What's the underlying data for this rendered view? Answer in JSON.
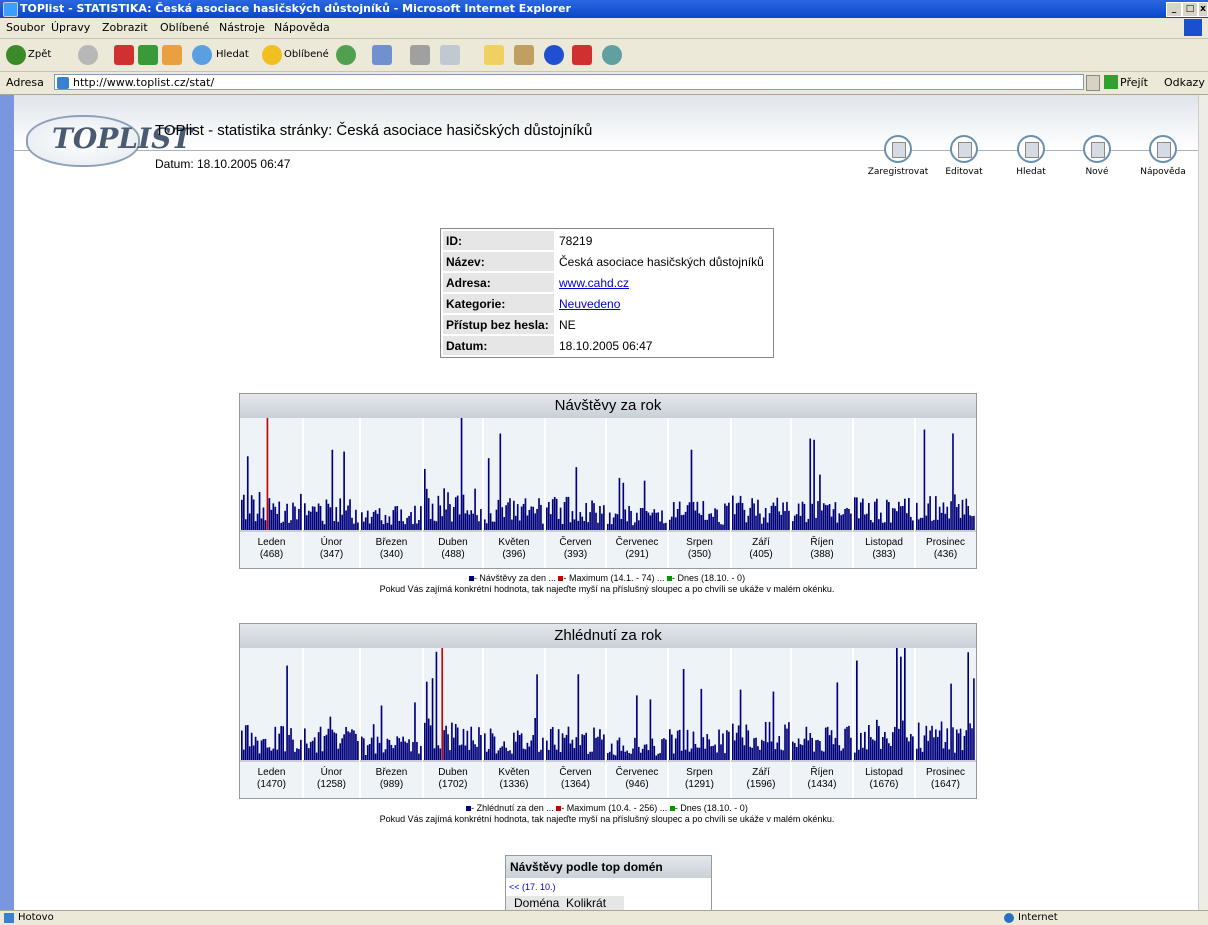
{
  "window": {
    "title": "TOPlist - STATISTIKA: Česká asociace hasičských důstojníků - Microsoft Internet Explorer"
  },
  "menu": [
    "Soubor",
    "Úpravy",
    "Zobrazit",
    "Oblíbené",
    "Nástroje",
    "Nápověda"
  ],
  "toolbar": {
    "back": "Zpět",
    "search": "Hledat",
    "favorites": "Oblíbené"
  },
  "address": {
    "label": "Adresa",
    "url": "http://www.toplist.cz/stat/",
    "go": "Přejít",
    "links": "Odkazy"
  },
  "status": {
    "text": "Hotovo",
    "zone": "Internet"
  },
  "header": {
    "logo_text": "TOPLIST",
    "title": "TOPlist - statistika stránky: Česká asociace hasičských důstojníků",
    "date": "Datum: 18.10.2005 06:47",
    "nav": [
      "Zaregistrovat",
      "Editovat",
      "Hledat",
      "Nové",
      "Nápověda"
    ]
  },
  "info": {
    "id_label": "ID:",
    "id": "78219",
    "name_label": "Název:",
    "name": "Česká asociace hasičských důstojníků",
    "address_label": "Adresa:",
    "address": "www.cahd.cz",
    "category_label": "Kategorie:",
    "category": "Neuvedeno",
    "access_label": "Přístup bez hesla:",
    "access": "NE",
    "date_label": "Datum:",
    "date": "18.10.2005 06:47"
  },
  "colors": {
    "bar": "#00007a",
    "max": "#cc0000",
    "today": "#009900"
  },
  "chart_data": [
    {
      "type": "bar",
      "title": "Návštěvy za rok",
      "categories": [
        "Leden",
        "Únor",
        "Březen",
        "Duben",
        "Květen",
        "Červen",
        "Červenec",
        "Srpen",
        "Září",
        "Říjen",
        "Listopad",
        "Prosinec"
      ],
      "totals": [
        "(468)",
        "(347)",
        "(340)",
        "(488)",
        "(396)",
        "(393)",
        "(291)",
        "(350)",
        "(405)",
        "(388)",
        "(383)",
        "(436)"
      ],
      "values": [
        468,
        347,
        340,
        488,
        396,
        393,
        291,
        350,
        405,
        388,
        383,
        436
      ],
      "max_day": 74,
      "legend": {
        "a": "- Návštěvy za den ...",
        "b": "- Maximum (14.1. - 74) ...",
        "c": "- Dnes (18.10. - 0)"
      },
      "hint": "Pokud Vás zajímá konkrétní hodnota, tak najeďte myší na příslušný sloupec a po chvíli se ukáže v malém okénku."
    },
    {
      "type": "bar",
      "title": "Zhlédnutí za rok",
      "categories": [
        "Leden",
        "Únor",
        "Březen",
        "Duben",
        "Květen",
        "Červen",
        "Červenec",
        "Srpen",
        "Září",
        "Říjen",
        "Listopad",
        "Prosinec"
      ],
      "totals": [
        "(1470)",
        "(1258)",
        "(989)",
        "(1702)",
        "(1336)",
        "(1364)",
        "(946)",
        "(1291)",
        "(1596)",
        "(1434)",
        "(1676)",
        "(1647)"
      ],
      "values": [
        1470,
        1258,
        989,
        1702,
        1336,
        1364,
        946,
        1291,
        1596,
        1434,
        1676,
        1647
      ],
      "max_day": 256,
      "legend": {
        "a": "- Zhlédnutí za den ...",
        "b": "- Maximum (10.4. - 256) ...",
        "c": "- Dnes (18.10. - 0)"
      },
      "hint": "Pokud Vás zajímá konkrétní hodnota, tak najeďte myší na příslušný sloupec a po chvíli se ukáže v malém okénku."
    }
  ],
  "domains": {
    "title": "Návštěvy podle top domén",
    "prev": "<< (17. 10.)",
    "col1": "Doména",
    "col2": "Kolikrát"
  }
}
